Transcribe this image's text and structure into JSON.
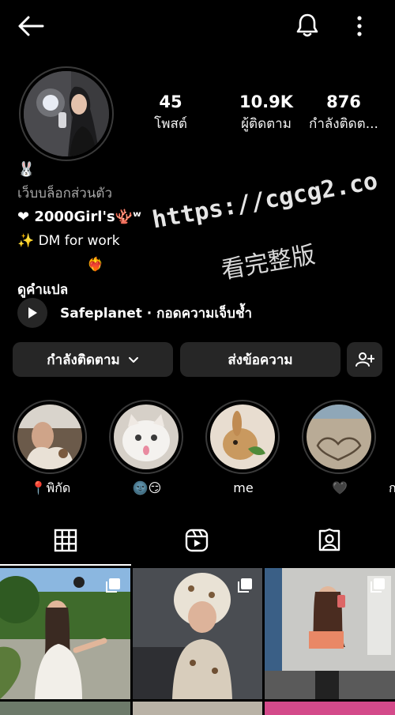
{
  "header": {
    "back_icon": "arrow-left-icon",
    "notification_icon": "bell-icon",
    "more_icon": "more-vertical-icon"
  },
  "profile": {
    "stats": [
      {
        "value": "45",
        "label": "โพสต์"
      },
      {
        "value": "10.9K",
        "label": "ผู้ติดตาม"
      },
      {
        "value": "876",
        "label": "กำลังติดต..."
      }
    ],
    "bio": {
      "emoji_line": "🐰 ",
      "category": "เว็บบล็อกส่วนตัว",
      "name_line": "❤ 2000Girl's🪸ʷ",
      "work_line": "✨ DM for work",
      "fire_line": "❤️‍🔥",
      "translate": "ดูคำแปล"
    },
    "music": {
      "text": "Safeplanet · กอดความเจ็บช้ำ",
      "icon": "play-icon"
    },
    "actions": {
      "following_label": "กำลังติดตาม",
      "message_label": "ส่งข้อความ",
      "add_user_icon": "add-user-icon"
    }
  },
  "highlights": [
    {
      "label": "📍พิกัด"
    },
    {
      "label": "🌚😏"
    },
    {
      "label": "me"
    },
    {
      "label": "🖤"
    },
    {
      "label": "ก"
    }
  ],
  "tabs": [
    {
      "icon": "grid-icon",
      "active": true
    },
    {
      "icon": "reels-icon",
      "active": false
    },
    {
      "icon": "tagged-icon",
      "active": false
    }
  ],
  "watermark": {
    "url": "https://cgcg2.co",
    "chinese": "看完整版"
  },
  "colors": {
    "background": "#000000",
    "button": "#262626",
    "muted_text": "#a8a8a8"
  }
}
